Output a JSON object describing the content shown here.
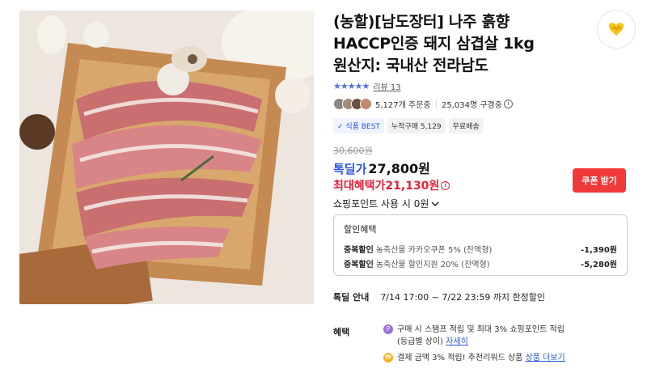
{
  "product": {
    "title_lines": [
      "(농할)[남도장터] 나주 흙향",
      "HACCP인증 돼지 삼겹살 1kg",
      "원산지: 국내산 전라남도"
    ],
    "rating_stars": "★★★★★",
    "review_label": "리뷰 13",
    "orders": "5,127개 주문중",
    "views": "25,034명 구경중",
    "tags": [
      "식품 BEST",
      "누적구매 5,129",
      "무료배송"
    ],
    "original_price": "30,600원",
    "deal_label": "톡딜가",
    "deal_price": "27,800원",
    "max_benefit": "최대혜택가21,130원",
    "coupon_button": "쿠폰 받기",
    "points_label": "쇼핑포인트 사용 시 0원",
    "discount": {
      "heading": "할인혜택",
      "rows": [
        {
          "key": "중복할인",
          "desc": "농축산물 카카오쿠폰 5% (잔액형)",
          "amount": "-1,390원"
        },
        {
          "key": "중복할인",
          "desc": "농축산물 할인지원 20% (잔액형)",
          "amount": "-5,280원"
        }
      ]
    },
    "deal_notice": {
      "label": "톡딜 안내",
      "text": "7/14 17:00 ~ 7/22 23:59 까지 한정할인"
    },
    "benefits": {
      "label": "혜택",
      "stamp_line1": "구매 시 스탬프 적립 및 최대 3% 쇼핑포인트 적립",
      "stamp_line2": "(등급별 상이)",
      "stamp_link": "자세히",
      "pay_text": "결제 금액 3% 적립! 추천리워드 상품",
      "pay_link": "상품 더보기"
    }
  },
  "colors": {
    "accent_blue": "#2a56e8",
    "accent_red": "#e8213a",
    "button_red": "#f03a3a"
  },
  "icons": [
    "favorite-icon",
    "info-icon",
    "chevron-down-icon",
    "stamp-icon",
    "reward-icon"
  ]
}
